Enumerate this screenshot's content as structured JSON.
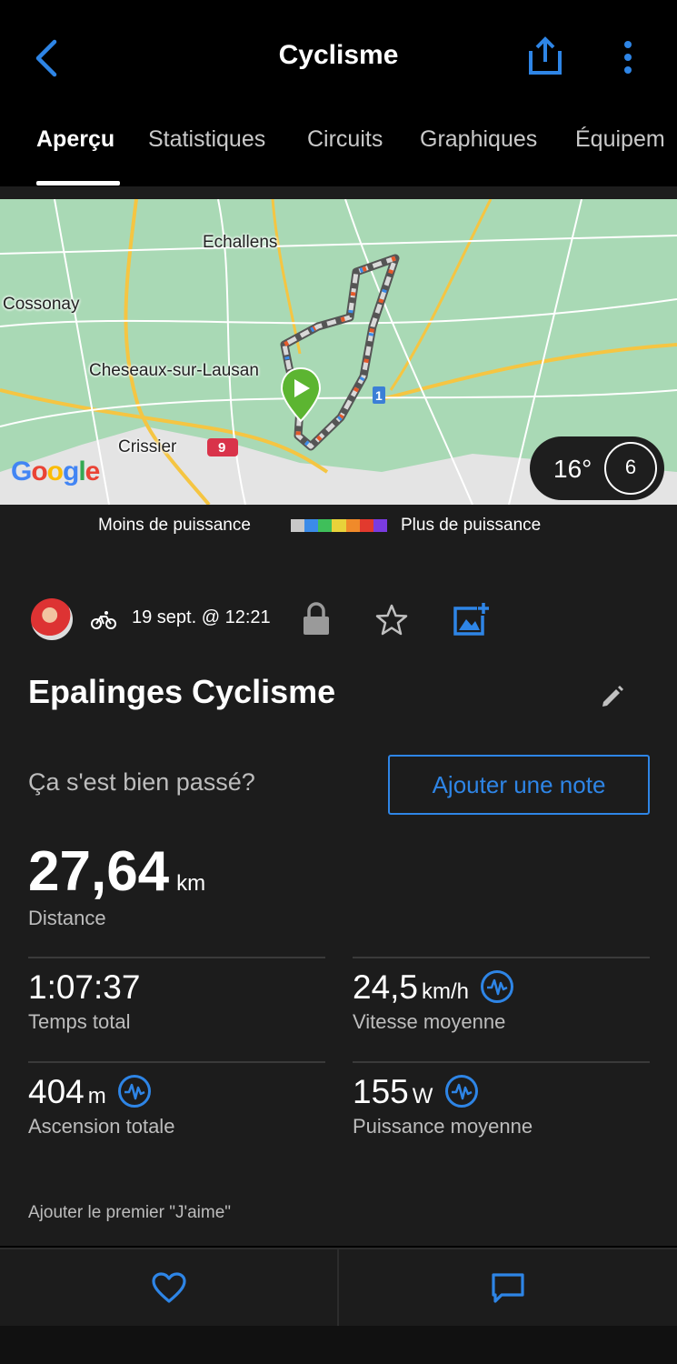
{
  "header": {
    "title": "Cyclisme"
  },
  "tabs": [
    {
      "label": "Aperçu",
      "active": true
    },
    {
      "label": "Statistiques"
    },
    {
      "label": "Circuits"
    },
    {
      "label": "Graphiques"
    },
    {
      "label": "Équipem"
    }
  ],
  "map": {
    "places": [
      "Echallens",
      "Cossonay",
      "Cheseaux-sur-Lausan",
      "Crissier"
    ],
    "road_badges": [
      "1",
      "9"
    ],
    "attribution": "Google",
    "temperature": "16°",
    "wind_speed": "6"
  },
  "legend": {
    "low_label": "Moins de puissance",
    "high_label": "Plus de puissance",
    "colors": [
      "#c8c8c8",
      "#3b8be8",
      "#3fbf5a",
      "#e8d23a",
      "#f08a2a",
      "#e23a2e",
      "#7a3be0"
    ]
  },
  "activity": {
    "date": "19 sept. @ 12:21",
    "title": "Epalinges Cyclisme",
    "question": "Ça s'est bien passé?",
    "add_note": "Ajouter une note",
    "distance": {
      "value": "27,64",
      "unit": "km",
      "label": "Distance"
    },
    "total_time": {
      "value": "1:07:37",
      "label": "Temps total"
    },
    "avg_speed": {
      "value": "24,5",
      "unit": "km/h",
      "label": "Vitesse moyenne"
    },
    "ascent": {
      "value": "404",
      "unit": "m",
      "label": "Ascension totale"
    },
    "avg_power": {
      "value": "155",
      "unit": "W",
      "label": "Puissance moyenne"
    },
    "likes_text": "Ajouter le premier \"J'aime\""
  },
  "colors": {
    "accent": "#2e85e6",
    "background": "#1c1c1c",
    "start_marker": "#5cb531"
  }
}
